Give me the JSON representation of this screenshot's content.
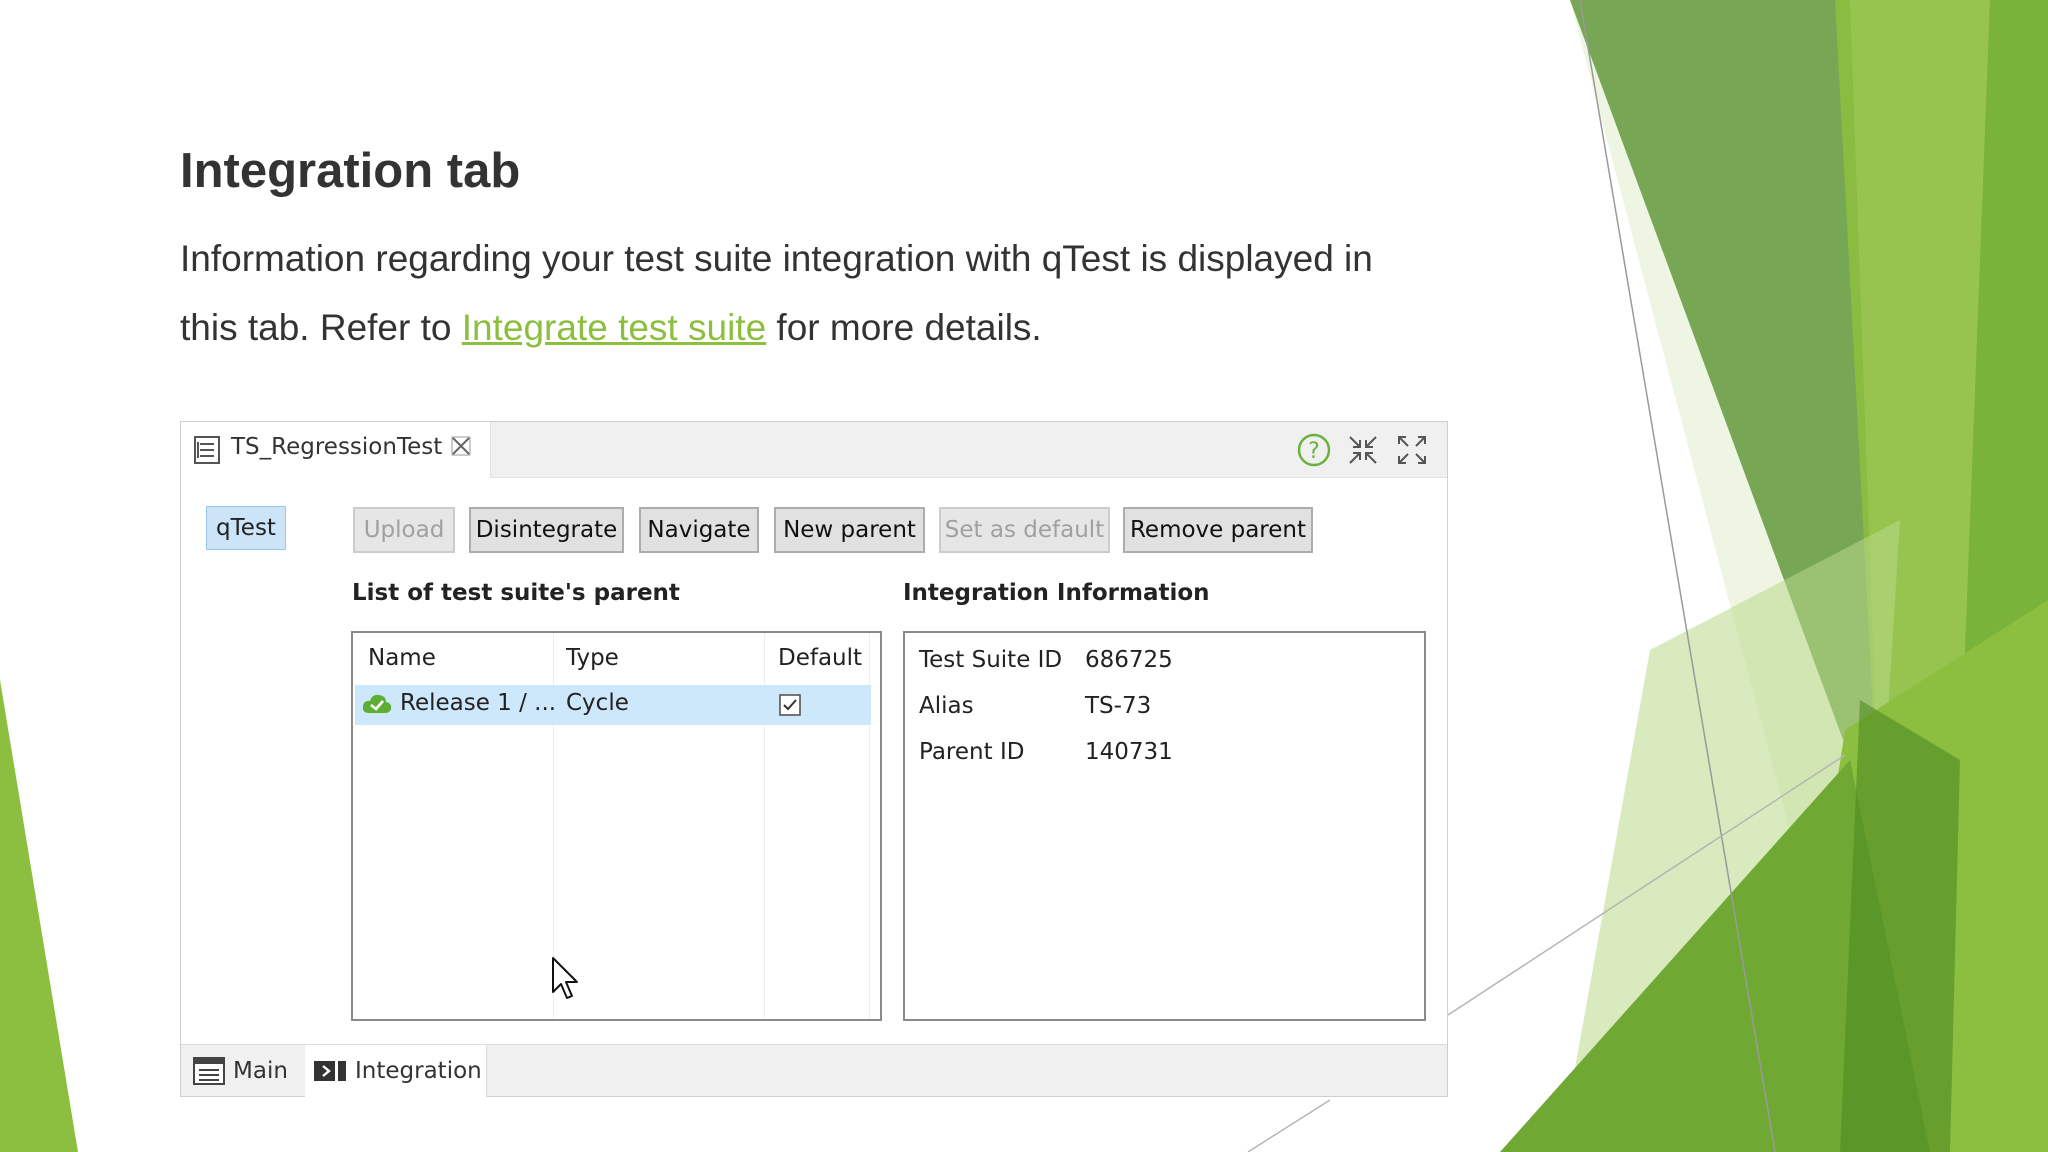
{
  "slide": {
    "title": "Integration tab",
    "para_before_link": "Information regarding your test suite integration with qTest is displayed in this tab. Refer to ",
    "link_text": "Integrate test suite",
    "para_after_link": " for more details."
  },
  "theme": {
    "accent": "#8cbf3f",
    "dark_green": "#4e8a23",
    "text": "#333333"
  },
  "window": {
    "tab_label": "TS_RegressionTest",
    "icons": [
      "document-icon",
      "close-tab-icon",
      "help-icon",
      "minimize-icon",
      "maximize-icon"
    ],
    "side_button": "qTest",
    "toolbar": {
      "upload": "Upload",
      "disintegrate": "Disintegrate",
      "navigate": "Navigate",
      "new_parent": "New parent",
      "set_default": "Set as default",
      "remove_parent": "Remove parent"
    },
    "parent_list": {
      "title": "List of test suite's parent",
      "columns": [
        "Name",
        "Type",
        "Default"
      ],
      "rows": [
        {
          "name": "Release 1 / ...",
          "type": "Cycle",
          "default": true
        }
      ]
    },
    "integration_info": {
      "title": "Integration Information",
      "fields": [
        {
          "key": "Test Suite ID",
          "value": "686725"
        },
        {
          "key": "Alias",
          "value": "TS-73"
        },
        {
          "key": "Parent ID",
          "value": "140731"
        }
      ]
    },
    "bottom_tabs": [
      "Main",
      "Integration"
    ]
  }
}
